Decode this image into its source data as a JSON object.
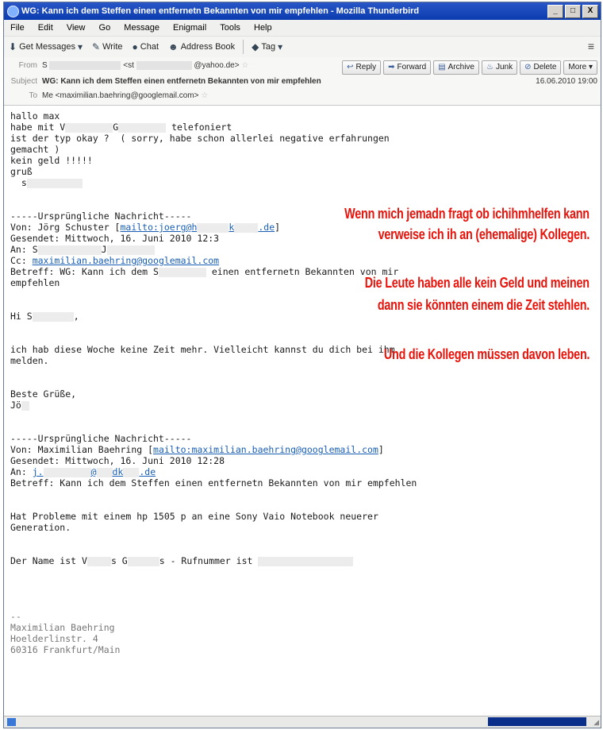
{
  "window": {
    "title": "WG: Kann ich dem Steffen einen entfernetn Bekannten von mir empfehlen - Mozilla Thunderbird",
    "controls": [
      "_",
      "□",
      "X"
    ]
  },
  "menu": [
    "File",
    "Edit",
    "View",
    "Go",
    "Message",
    "Enigmail",
    "Tools",
    "Help"
  ],
  "toolbar": {
    "get_messages": "Get Messages",
    "write": "Write",
    "chat": "Chat",
    "address_book": "Address Book",
    "tag": "Tag"
  },
  "header": {
    "from_label": "From",
    "from_value": "S",
    "from_mid": "<st",
    "from_domain": "@yahoo.de>",
    "subject_label": "Subject",
    "subject_value": "WG: Kann ich dem Steffen einen entfernetn Bekannten von mir empfehlen",
    "date": "16.06.2010 19:00",
    "to_label": "To",
    "to_value": "Me <maximilian.baehring@googlemail.com>",
    "buttons": {
      "reply": "Reply",
      "forward": "Forward",
      "archive": "Archive",
      "junk": "Junk",
      "delete": "Delete",
      "more": "More"
    }
  },
  "body": {
    "l01": "hallo max",
    "l02a": "habe mit V",
    "l02b": "G",
    "l02c": "telefoniert",
    "l03": "ist der typ okay ?  ( sorry, habe schon allerlei negative erfahrungen",
    "l04": "gemacht )",
    "l05": "kein geld !!!!!",
    "l06": "gruß",
    "l07": "  s",
    "l09": "-----Ursprüngliche Nachricht-----",
    "l10a": "Von: Jörg Schuster [",
    "l10b": "mailto:joerg@h",
    "l10c": "k",
    "l10d": ".de",
    "l10e": "]",
    "l11": "Gesendet: Mittwoch, 16. Juni 2010 12:3",
    "l12a": "An: S",
    "l12b": "J",
    "l13a": "Cc: ",
    "l13b": "maximilian.baehring@googlemail.com",
    "l14a": "Betreff: WG: Kann ich dem S",
    "l14b": " einen entfernetn Bekannten von mir",
    "l15": "empfehlen",
    "l17a": "Hi S",
    "l17b": ",",
    "l19": "ich hab diese Woche keine Zeit mehr. Vielleicht kannst du dich bei ihm",
    "l20": "melden.",
    "l22": "Beste Grüße,",
    "l23": "Jö",
    "l25": "-----Ursprüngliche Nachricht-----",
    "l26a": "Von: Maximilian Baehring [",
    "l26b": "mailto:maximilian.baehring@googlemail.com",
    "l26c": "]",
    "l27": "Gesendet: Mittwoch, 16. Juni 2010 12:28",
    "l28a": "An: ",
    "l28b": "j.",
    "l28c": "@",
    "l28d": "dk",
    "l28e": ".de",
    "l29": "Betreff: Kann ich dem Steffen einen entfernetn Bekannten von mir empfehlen",
    "l31": "Hat Probleme mit einem hp 1505 p an eine Sony Vaio Notebook neuerer",
    "l32": "Generation.",
    "l34a": "Der Name ist V",
    "l34b": "s G",
    "l34c": "s - Rufnummer ist",
    "l37": "--",
    "l38": "Maximilian Baehring",
    "l39": "Hoelderlinstr. 4",
    "l40": "60316 Frankfurt/Main"
  },
  "annotations": {
    "a1": "Wenn mich jemadn fragt ob ichihmhelfen kann",
    "a2": "verweise ich ih an (ehemalige) Kollegen.",
    "a3": "Die Leute haben alle kein Geld und meinen",
    "a4": "dann sie könnten einem die Zeit stehlen.",
    "a5": "Und die Kollegen müssen davon leben."
  },
  "colors": {
    "annotation": "#e8140c",
    "link": "#1a5fb4",
    "titlebar": "#0a3cb0"
  }
}
